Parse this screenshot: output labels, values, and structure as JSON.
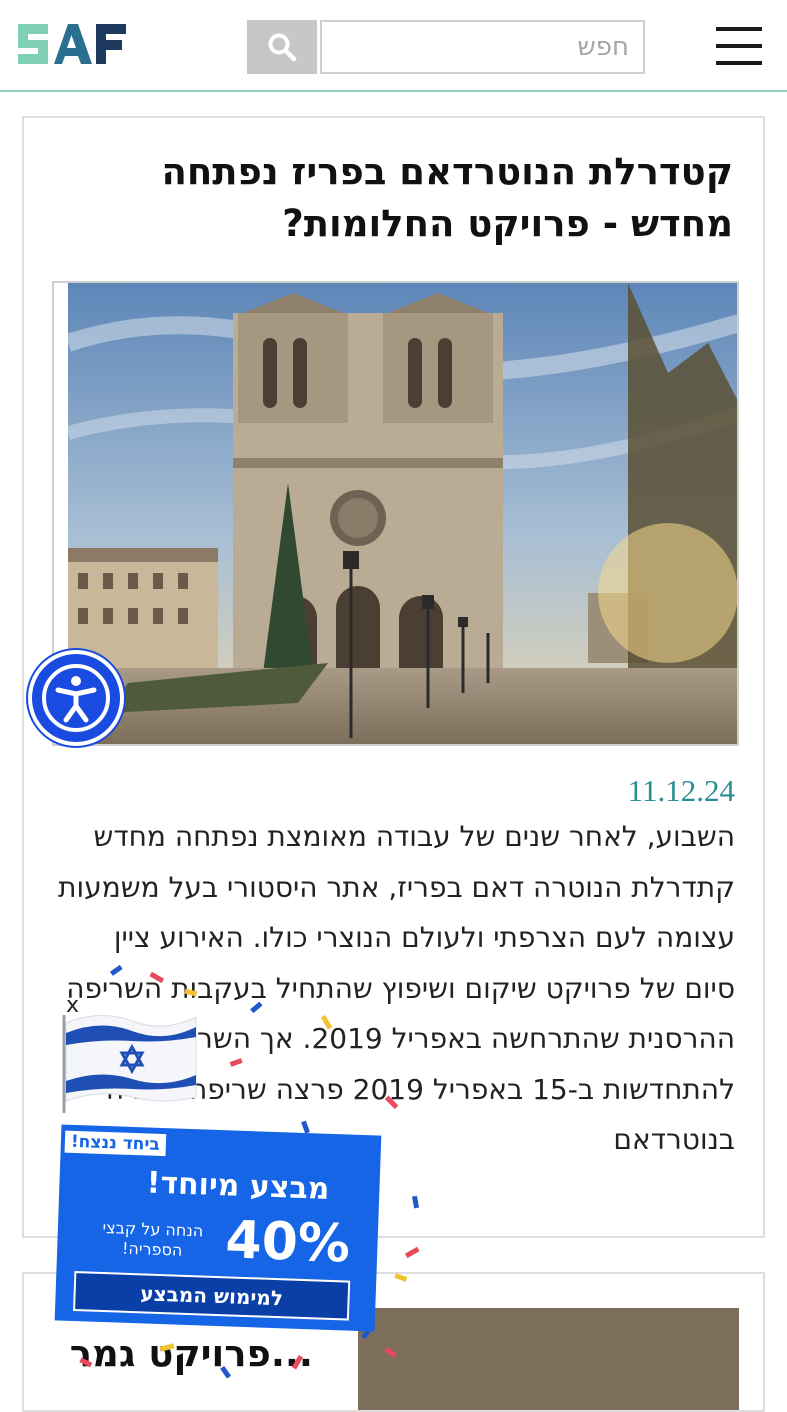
{
  "header": {
    "logo_text": "SAF",
    "search_placeholder": "חפש",
    "search_icon": "search-icon",
    "menu_icon": "hamburger-menu-icon"
  },
  "article": {
    "title": "קטדרלת הנוטרדאם בפריז נפתחה מחדש - פרויקט החלומות?",
    "image_alt": "קתדרלת נוטרדאם בפריז",
    "date": "11.12.24",
    "body": "השבוע, לאחר שנים של עבודה מאומצת נפתחה מחדש קתדרלת הנוטרה דאם בפריז, אתר היסטורי בעל משמעות עצומה לעם הצרפתי ולעולם הנוצרי כולו. האירוע ציין סיום של פרויקט שיקום ושיפוץ שהתחיל בעקבות השריפה ההרסנית שהתרחשה באפריל 2019. אך השריפה שהוביל להתחדשות ב-15 באפריל 2019 פרצה שריפה אדירה בנוטרדאם"
  },
  "next_article": {
    "title": "...פרויקט גמר"
  },
  "accessibility": {
    "icon": "accessibility-icon"
  },
  "promo": {
    "close_label": "x",
    "tag": "ביחד ננצח!",
    "headline": "מבצע מיוחד!",
    "discount": "40%",
    "subtitle": "הנחה על קבצי הספריה!",
    "cta": "למימוש המבצע"
  },
  "colors": {
    "accent": "#2a8f93",
    "header_border": "#8fd1bf",
    "promo_blue": "#1565e6",
    "a11y_blue": "#1a4be0"
  }
}
